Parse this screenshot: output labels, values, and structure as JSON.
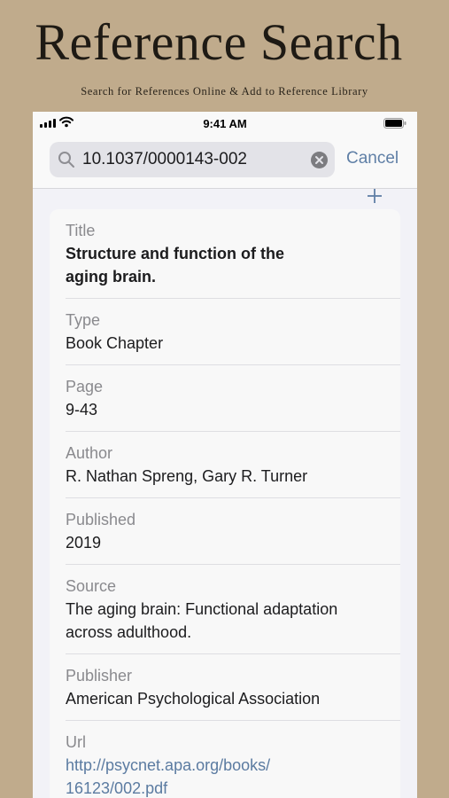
{
  "promo": {
    "title": "Reference Search",
    "subtitle": "Search for References Online & Add to Reference Library"
  },
  "status_bar": {
    "time": "9:41 AM"
  },
  "search": {
    "value": "10.1037/0000143-002",
    "cancel_label": "Cancel"
  },
  "icons": {
    "search": "search-icon",
    "clear": "clear-icon",
    "add": "plus-icon",
    "signal": "cellular-signal-icon",
    "wifi": "wifi-icon",
    "battery": "battery-icon"
  },
  "colors": {
    "background": "#c0ab8c",
    "accent": "#5f7fa6",
    "link": "#5b7ba1",
    "label": "#8a8a8e"
  },
  "reference": {
    "title_label": "Title",
    "title_line1": "Structure and function of the",
    "title_line2": "aging brain.",
    "type_label": "Type",
    "type": "Book Chapter",
    "page_label": "Page",
    "page": "9-43",
    "author_label": "Author",
    "author": "R. Nathan Spreng, Gary R. Turner",
    "published_label": "Published",
    "published": "2019",
    "source_label": "Source",
    "source_line1": "The aging brain: Functional adaptation",
    "source_line2": "across adulthood.",
    "publisher_label": "Publisher",
    "publisher": "American Psychological Association",
    "url_label": "Url",
    "url_line1": "http://psycnet.apa.org/books/",
    "url_line2": "16123/002.pdf"
  }
}
